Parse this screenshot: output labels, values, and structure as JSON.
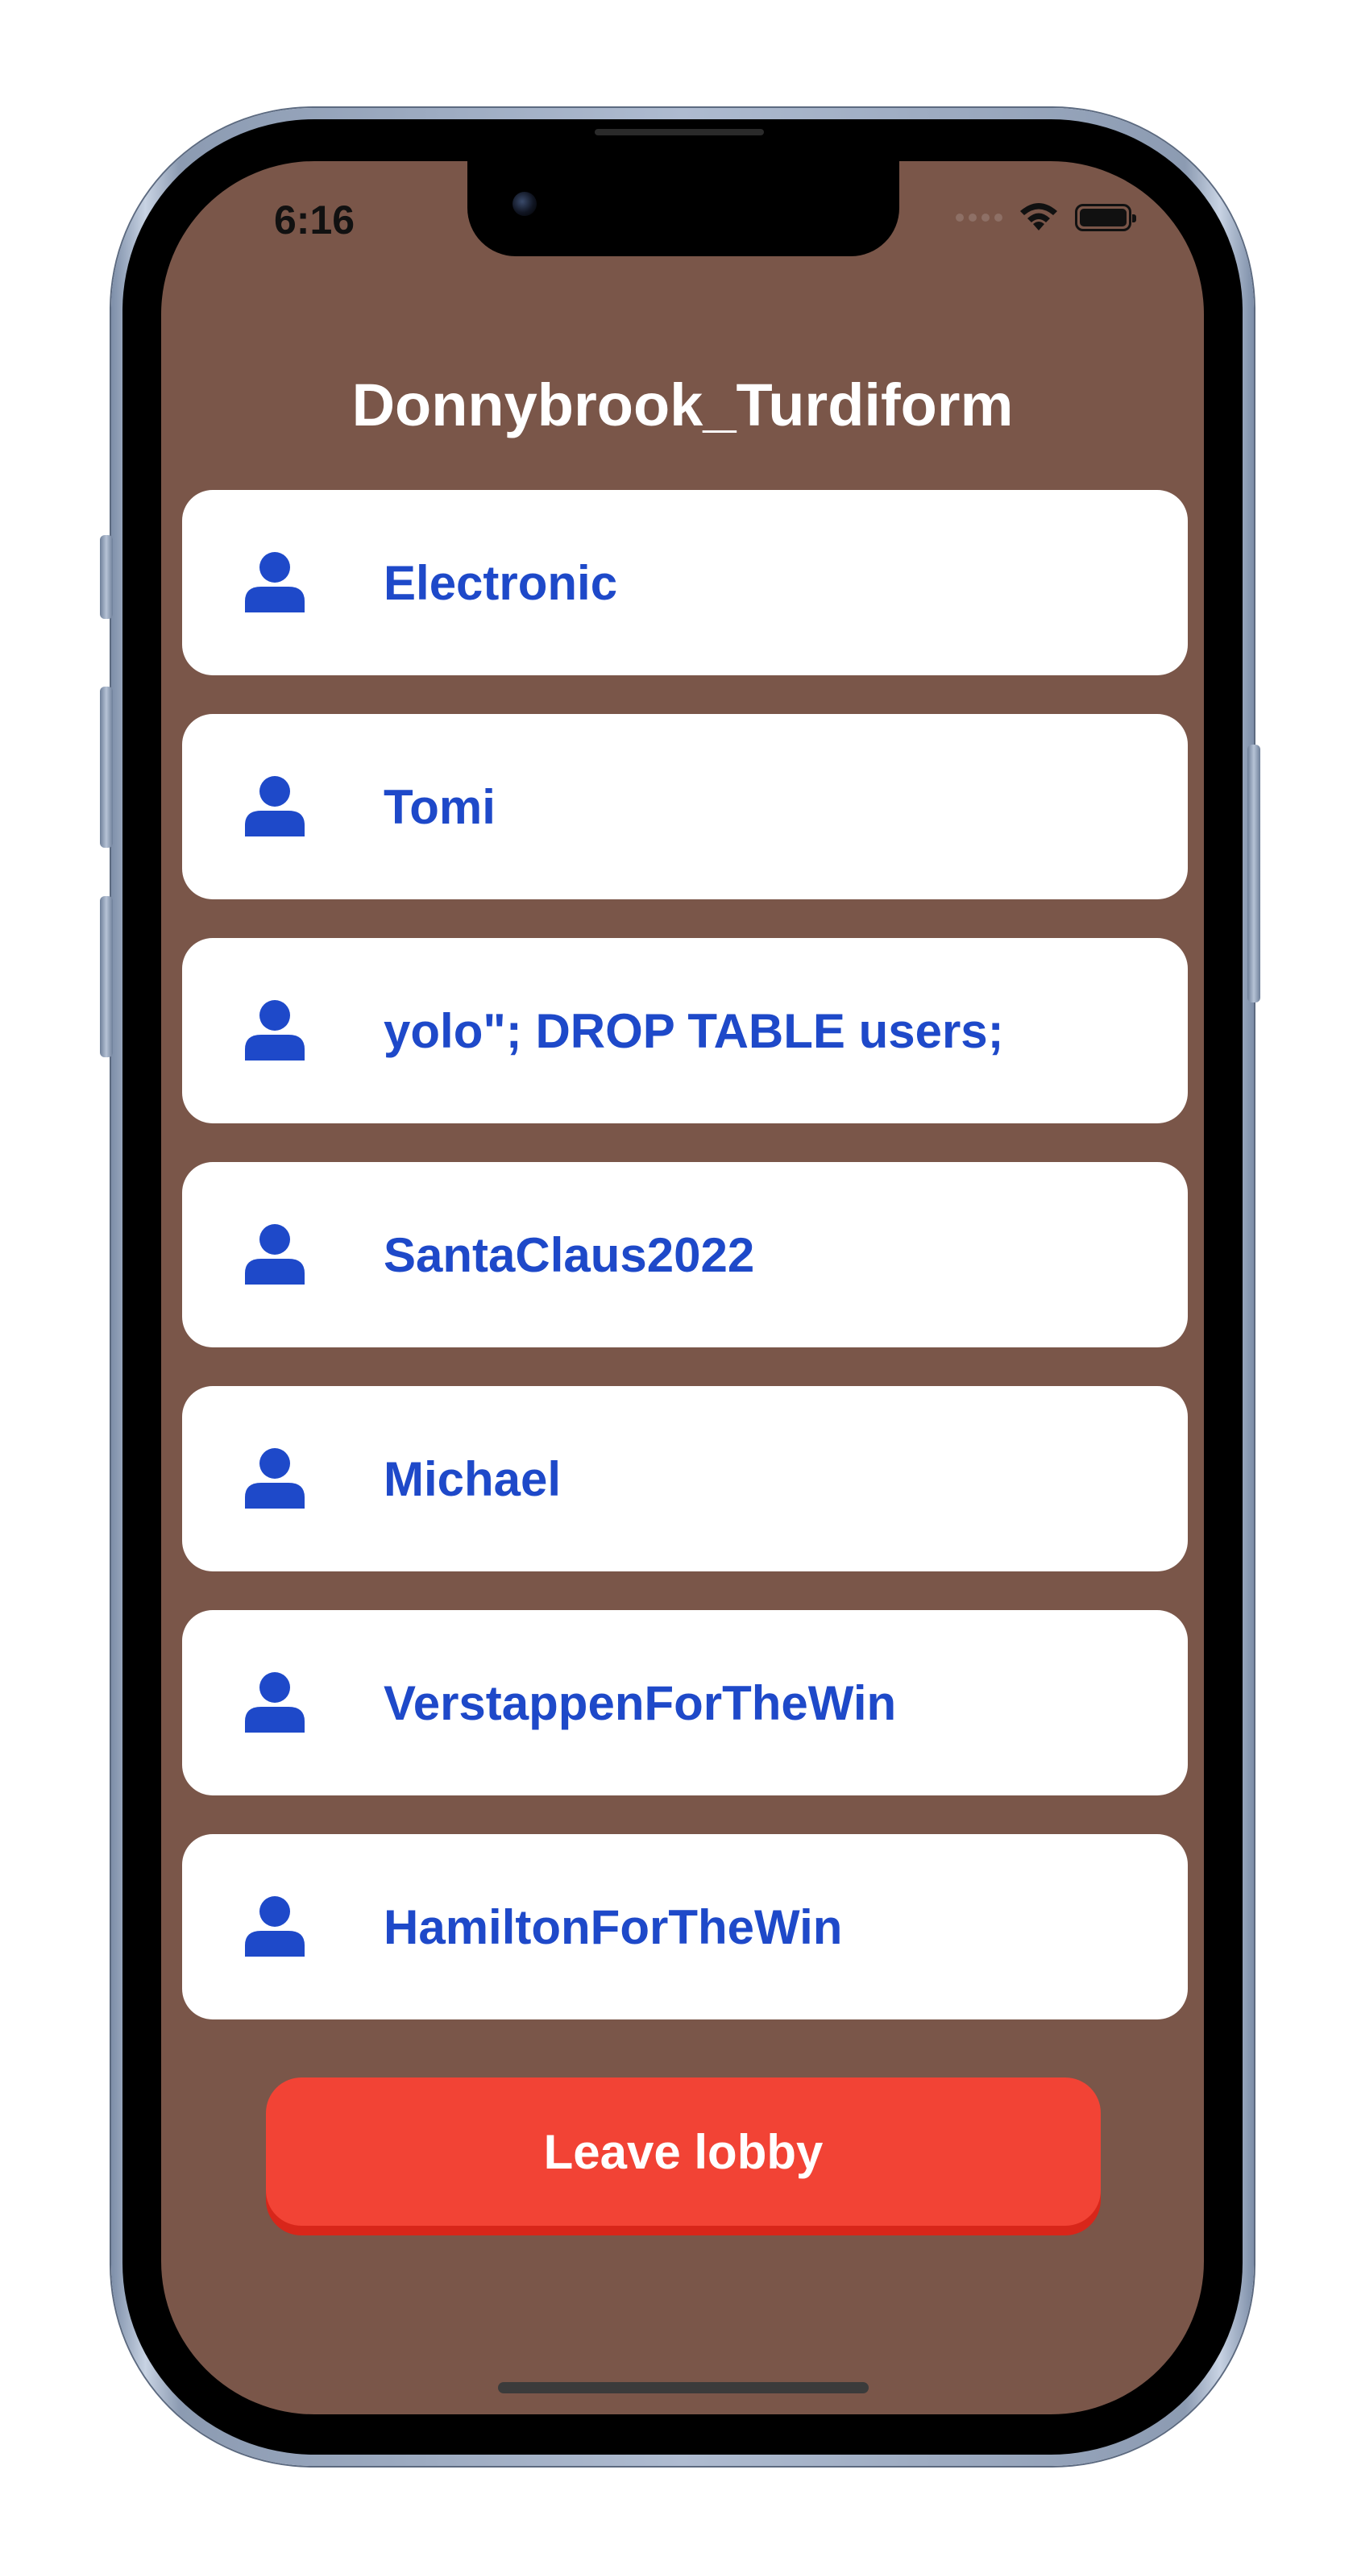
{
  "status_bar": {
    "time": "6:16"
  },
  "lobby": {
    "title": "Donnybrook_Turdiform",
    "players": [
      {
        "name": "Electronic",
        "icon": "user-icon"
      },
      {
        "name": "Tomi",
        "icon": "user-icon"
      },
      {
        "name": "yolo\"; DROP TABLE users;",
        "icon": "user-icon"
      },
      {
        "name": "SantaClaus2022",
        "icon": "user-icon"
      },
      {
        "name": "Michael",
        "icon": "user-icon"
      },
      {
        "name": "VerstappenForTheWin",
        "icon": "user-icon"
      },
      {
        "name": "HamiltonForTheWin",
        "icon": "user-icon"
      }
    ],
    "leave_label": "Leave lobby"
  },
  "colors": {
    "background": "#7a5649",
    "card": "#ffffff",
    "player_text": "#1e49c9",
    "leave_button": "#f24335",
    "leave_button_shadow": "#d8261a"
  }
}
